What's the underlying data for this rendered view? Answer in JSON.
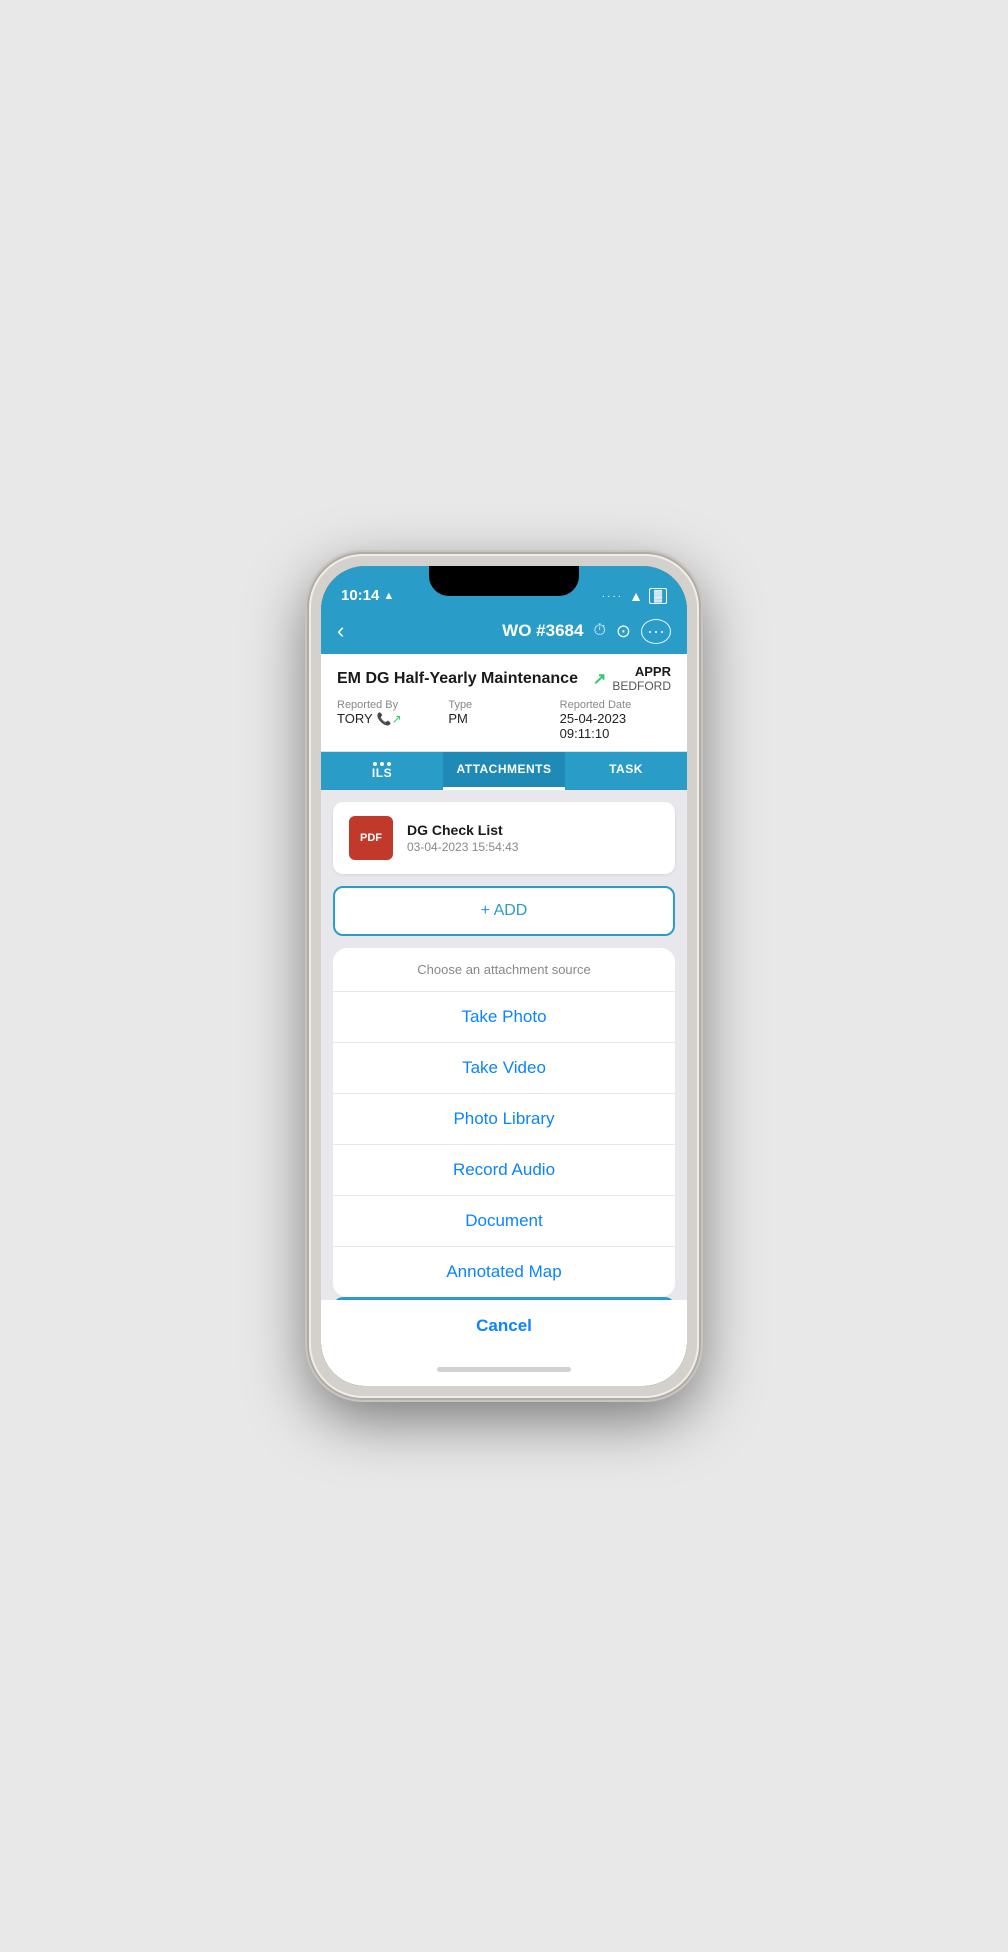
{
  "status_bar": {
    "time": "10:14",
    "navigation_arrow": "▲"
  },
  "header": {
    "back_label": "‹",
    "title": "WO #3684",
    "icon_timer": "⏱",
    "icon_location": "📍",
    "icon_more": "•••"
  },
  "work_order": {
    "title": "EM DG Half-Yearly Maintenance",
    "status_label": "APPR",
    "status_location": "BEDFORD",
    "status_arrow": "↗",
    "reported_by_label": "Reported By",
    "reported_by_value": "TORY",
    "type_label": "Type",
    "type_value": "PM",
    "reported_date_label": "Reported Date",
    "reported_date_value": "25-04-2023 09:11:10"
  },
  "tabs": [
    {
      "id": "details",
      "label": "ILS",
      "has_dots": true
    },
    {
      "id": "attachments",
      "label": "ATTACHMENTS",
      "active": true
    },
    {
      "id": "task",
      "label": "TASK"
    }
  ],
  "attachment": {
    "badge": "PDF",
    "name": "DG Check List",
    "date": "03-04-2023 15:54:43"
  },
  "add_button_label": "+ ADD",
  "action_sheet": {
    "title": "Choose an attachment source",
    "items": [
      {
        "id": "take-photo",
        "label": "Take Photo"
      },
      {
        "id": "take-video",
        "label": "Take Video"
      },
      {
        "id": "photo-library",
        "label": "Photo Library"
      },
      {
        "id": "record-audio",
        "label": "Record Audio"
      },
      {
        "id": "document",
        "label": "Document"
      },
      {
        "id": "annotated-map",
        "label": "Annotated Map"
      }
    ],
    "cancel_label": "Cancel"
  }
}
